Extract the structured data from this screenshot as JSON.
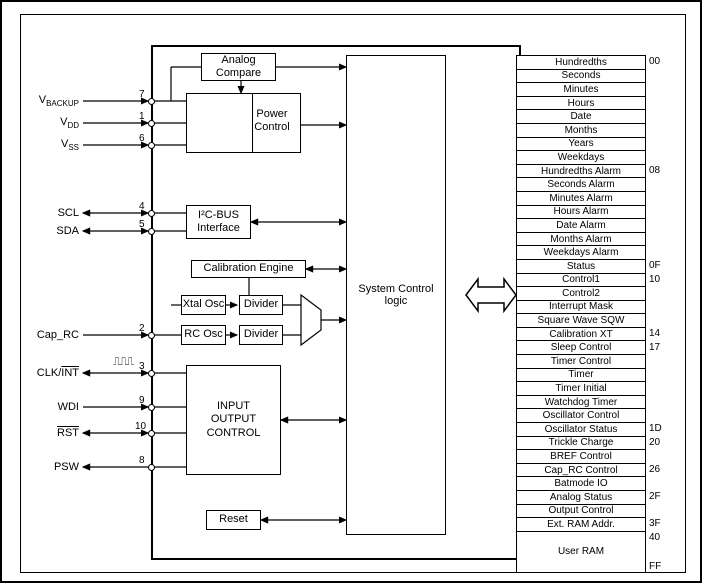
{
  "pins": {
    "vbackup": {
      "label_html": "V<sub>BACKUP</sub>",
      "num": "7"
    },
    "vdd": {
      "label_html": "V<sub>DD</sub>",
      "num": "1"
    },
    "vss": {
      "label_html": "V<sub>SS</sub>",
      "num": "6"
    },
    "scl": {
      "label": "SCL",
      "num": "4"
    },
    "sda": {
      "label": "SDA",
      "num": "5"
    },
    "cap_rc": {
      "label": "Cap_RC",
      "num": "2"
    },
    "clkint": {
      "label_html": "CLK/<span class='overline'>INT</span>",
      "num": "3"
    },
    "wdi": {
      "label": "WDI",
      "num": "9"
    },
    "rst": {
      "label_html": "<span class='overline'>RST</span>",
      "num": "10"
    },
    "psw": {
      "label": "PSW",
      "num": "8"
    }
  },
  "blocks": {
    "analog_compare": "Analog\nCompare",
    "power_control": "Power\nControl",
    "i2c": "I²C-BUS\nInterface",
    "calibration_engine": "Calibration Engine",
    "xtal_osc": "Xtal Osc",
    "rc_osc": "RC Osc",
    "divider1": "Divider",
    "divider2": "Divider",
    "io_control": "INPUT\nOUTPUT\nCONTROL",
    "reset": "Reset",
    "system_control": "System Control\nlogic"
  },
  "registers": [
    "Hundredths",
    "Seconds",
    "Minutes",
    "Hours",
    "Date",
    "Months",
    "Years",
    "Weekdays",
    "Hundredths Alarm",
    "Seconds Alarm",
    "Minutes Alarm",
    "Hours Alarm",
    "Date Alarm",
    "Months Alarm",
    "Weekdays Alarm",
    "Status",
    "Control1",
    "Control2",
    "Interrupt Mask",
    "Square Wave SQW",
    "Calibration XT",
    "Sleep Control",
    "Timer Control",
    "Timer",
    "Timer Initial",
    "Watchdog Timer",
    "Oscillator Control",
    "Oscillator Status",
    "Trickle Charge",
    "BREF Control",
    "Cap_RC Control",
    "Batmode IO",
    "Analog Status",
    "Output Control",
    "Ext. RAM Addr."
  ],
  "user_ram": "User RAM",
  "reg_addrs": [
    {
      "val": "00",
      "idx": 0
    },
    {
      "val": "08",
      "idx": 8
    },
    {
      "val": "0F",
      "idx": 15
    },
    {
      "val": "10",
      "idx": 16
    },
    {
      "val": "14",
      "idx": 20
    },
    {
      "val": "17",
      "idx": 21
    },
    {
      "val": "1D",
      "idx": 27
    },
    {
      "val": "20",
      "idx": 28
    },
    {
      "val": "26",
      "idx": 30
    },
    {
      "val": "2F",
      "idx": 32
    },
    {
      "val": "3F",
      "idx": 34
    }
  ],
  "user_ram_addrs": {
    "top": "40",
    "bottom": "FF"
  }
}
